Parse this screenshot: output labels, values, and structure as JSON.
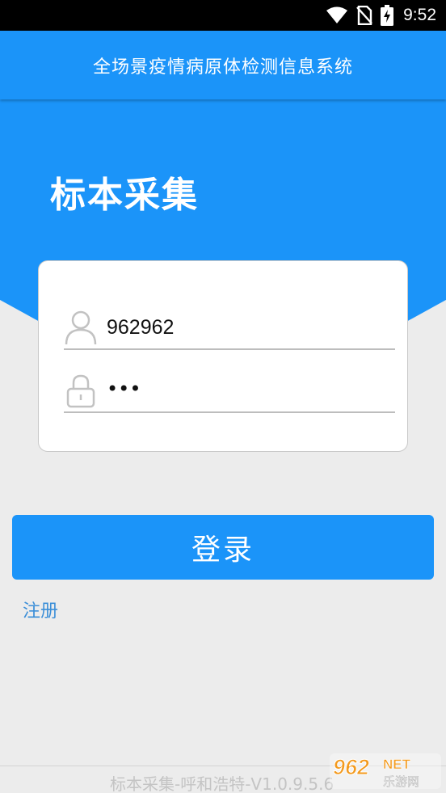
{
  "status_bar": {
    "time": "9:52",
    "icons": [
      "wifi-icon",
      "no-sim-icon",
      "battery-charging-icon"
    ]
  },
  "header": {
    "title": "全场景疫情病原体检测信息系统"
  },
  "hero": {
    "heading": "标本采集"
  },
  "login_form": {
    "username_icon": "user-icon",
    "username_value": "962962",
    "password_icon": "lock-icon",
    "password_value": "•••"
  },
  "actions": {
    "login_label": "登录",
    "register_label": "注册"
  },
  "footer": {
    "version_text": "标本采集-呼和浩特-V1.0.9.5.6",
    "watermark_number": "962",
    "watermark_suffix": "NET",
    "watermark_text": "乐游网"
  },
  "colors": {
    "primary": "#1b94f9",
    "background": "#ececec",
    "link": "#3c8fd8"
  }
}
